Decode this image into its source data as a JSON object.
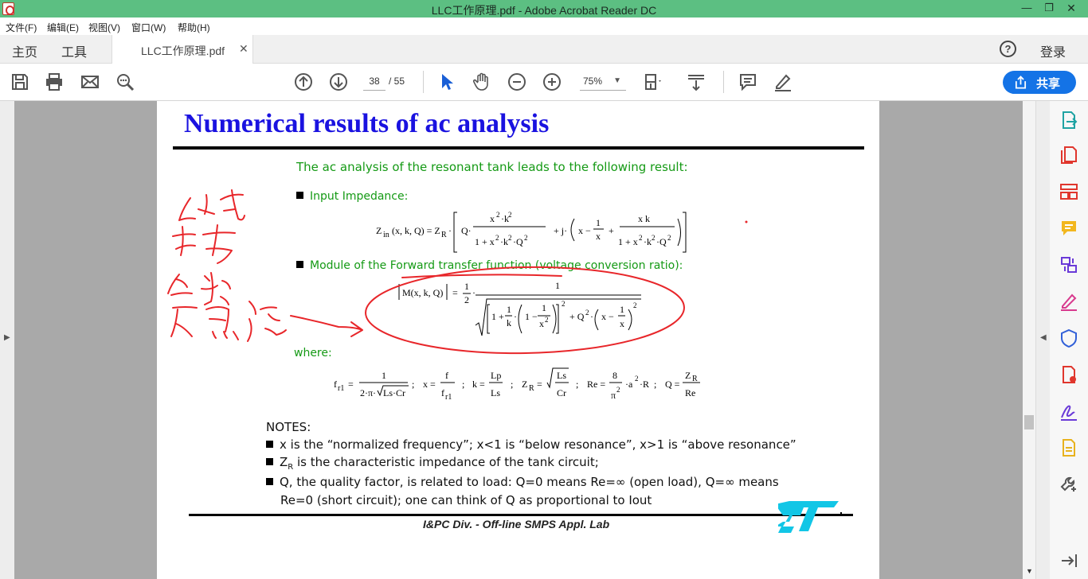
{
  "window": {
    "title": "LLC工作原理.pdf - Adobe Acrobat Reader DC",
    "controls": [
      "minimize",
      "restore",
      "close"
    ]
  },
  "menu": {
    "items": [
      "文件(F)",
      "编辑(E)",
      "视图(V)",
      "窗口(W)",
      "帮助(H)"
    ]
  },
  "tabs": {
    "home": "主页",
    "tools": "工具",
    "document": "LLC工作原理.pdf",
    "login": "登录"
  },
  "toolbar": {
    "current_page": "38",
    "total_pages": "/ 55",
    "zoom": "75%",
    "share_label": "共享",
    "icons": [
      "save-icon",
      "print-icon",
      "email-icon",
      "search-icon",
      "page-up-icon",
      "page-down-icon",
      "select-cursor-icon",
      "hand-tool-icon",
      "zoom-out-icon",
      "zoom-in-icon",
      "fit-page-icon",
      "scroll-mode-icon",
      "comment-icon",
      "sign-icon"
    ]
  },
  "right_panel": {
    "icons": [
      "export-pdf-icon",
      "create-pdf-icon",
      "organize-pages-icon",
      "comment-tool-icon",
      "combine-files-icon",
      "fill-sign-icon",
      "protect-icon",
      "send-review-icon",
      "signature-icon",
      "stamp-icon",
      "more-tools-icon",
      "collapse-panel-icon"
    ],
    "accent": "#1473e6"
  },
  "document": {
    "title": "Numerical results of ac analysis",
    "intro": "The ac analysis of the resonant tank leads to the following result:",
    "input_impedance_label": "Input Impedance:",
    "module_label": "Module of the Forward transfer function (voltage conversion ratio):",
    "where_label": "where:",
    "notes_title": "NOTES:",
    "note1": "x is the “normalized frequency”; x<1 is “below resonance”, x>1 is “above resonance”",
    "note2_main": "Z",
    "note2_sub": "R",
    "note2_rest": " is the characteristic impedance of the tank circuit;",
    "note3_line1": "Q, the quality factor, is related to load: Q=0 means Re=∞ (open load), Q=∞ means",
    "note3_line2": "Re=0 (short circuit); one can think of Q as proportional to Iout",
    "footer": "I&PC Div. - Off-line SMPS Appl. Lab",
    "title_color": "#1a12e0",
    "text_color": "#159a15",
    "logo_color": "#12c6e6",
    "annotation_color": "#e8262a"
  }
}
